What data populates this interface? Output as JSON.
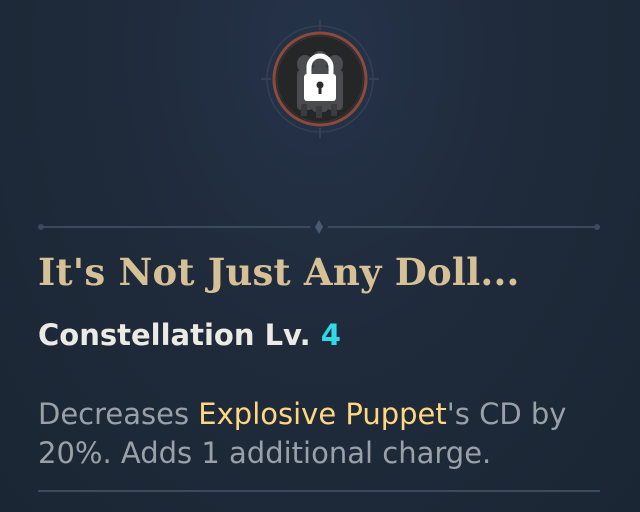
{
  "constellation": {
    "icon": "lock-icon",
    "locked": true,
    "title": "It's Not Just Any Doll...",
    "level_label": "Constellation Lv. ",
    "level_value": "4",
    "description": {
      "part1": "Decreases ",
      "highlight": "Explosive Puppet",
      "part2": "'s CD by 20%. Adds 1 additional charge."
    }
  },
  "colors": {
    "background": "#1e2a39",
    "title": "#d6c196",
    "level_number": "#31d9e6",
    "highlight": "#ffd780",
    "description": "#9aa0a8",
    "icon_ring": "#8a4a3c"
  }
}
